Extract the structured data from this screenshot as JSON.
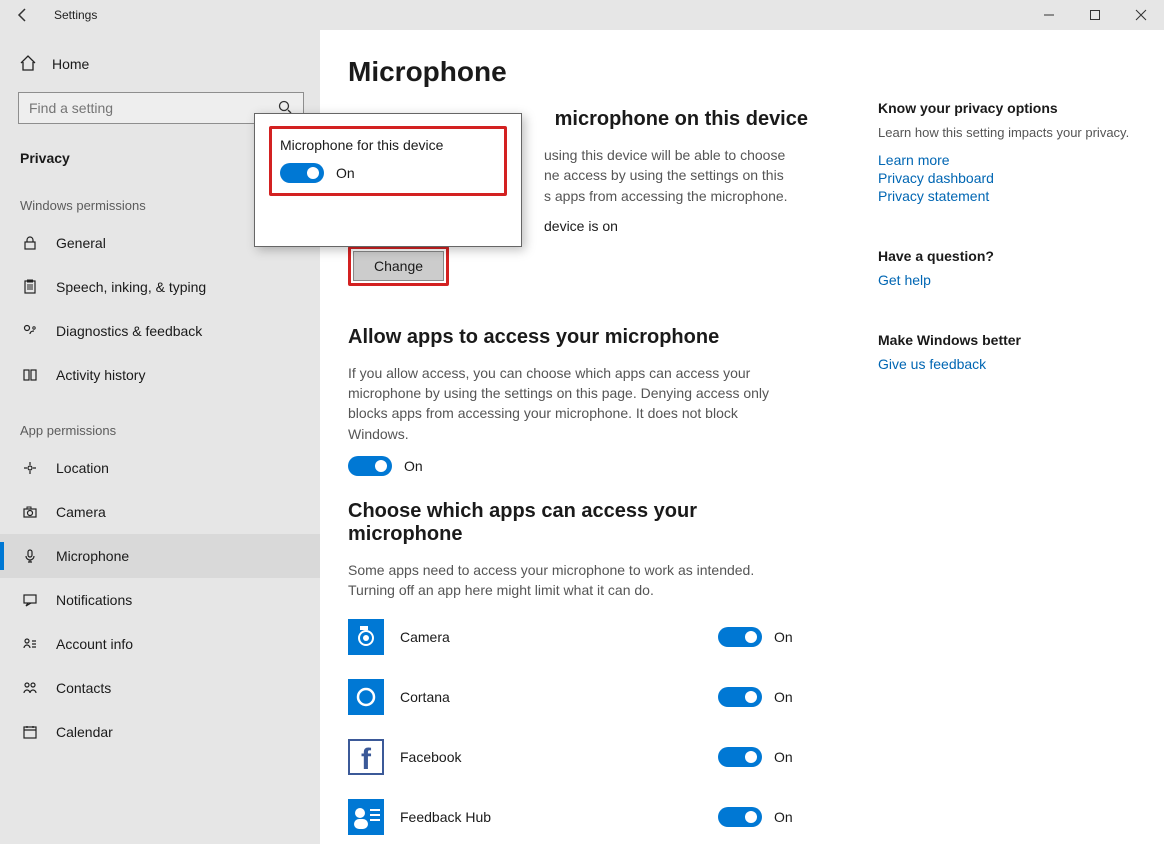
{
  "window": {
    "title": "Settings"
  },
  "sidebar": {
    "home": "Home",
    "search_placeholder": "Find a setting",
    "category": "Privacy",
    "windows_permissions_header": "Windows permissions",
    "app_permissions_header": "App permissions",
    "win_items": [
      {
        "id": "general",
        "label": "General"
      },
      {
        "id": "speech",
        "label": "Speech, inking, & typing"
      },
      {
        "id": "diagnostics",
        "label": "Diagnostics & feedback"
      },
      {
        "id": "activity",
        "label": "Activity history"
      }
    ],
    "app_items": [
      {
        "id": "location",
        "label": "Location"
      },
      {
        "id": "camera",
        "label": "Camera"
      },
      {
        "id": "microphone",
        "label": "Microphone"
      },
      {
        "id": "notifications",
        "label": "Notifications"
      },
      {
        "id": "account",
        "label": "Account info"
      },
      {
        "id": "contacts",
        "label": "Contacts"
      },
      {
        "id": "calendar",
        "label": "Calendar"
      }
    ]
  },
  "main": {
    "page_title": "Microphone",
    "s1": {
      "heading_suffix": "microphone on this device",
      "desc_part": "using this device will be able to choose ne access by using the settings on this s apps from accessing the microphone.",
      "status_suffix": "device is on",
      "change_label": "Change"
    },
    "s2": {
      "heading": "Allow apps to access your microphone",
      "desc": "If you allow access, you can choose which apps can access your microphone by using the settings on this page. Denying access only blocks apps from accessing your microphone. It does not block Windows.",
      "toggle_label": "On"
    },
    "s3": {
      "heading": "Choose which apps can access your microphone",
      "desc": "Some apps need to access your microphone to work as intended. Turning off an app here might limit what it can do.",
      "apps": [
        {
          "id": "camera-app",
          "label": "Camera",
          "state": "On",
          "color": "#0078d4",
          "kind": "camera"
        },
        {
          "id": "cortana-app",
          "label": "Cortana",
          "state": "On",
          "color": "#0078d4",
          "kind": "cortana"
        },
        {
          "id": "facebook-app",
          "label": "Facebook",
          "state": "On",
          "color": "#3b5998",
          "kind": "facebook"
        },
        {
          "id": "feedback-app",
          "label": "Feedback Hub",
          "state": "On",
          "color": "#0078d4",
          "kind": "feedback"
        }
      ]
    }
  },
  "right": {
    "privacy": {
      "title": "Know your privacy options",
      "desc": "Learn how this setting impacts your privacy.",
      "links": [
        "Learn more",
        "Privacy dashboard",
        "Privacy statement"
      ]
    },
    "question": {
      "title": "Have a question?",
      "link": "Get help"
    },
    "feedback": {
      "title": "Make Windows better",
      "link": "Give us feedback"
    }
  },
  "flyout": {
    "title": "Microphone for this device",
    "toggle_label": "On"
  }
}
